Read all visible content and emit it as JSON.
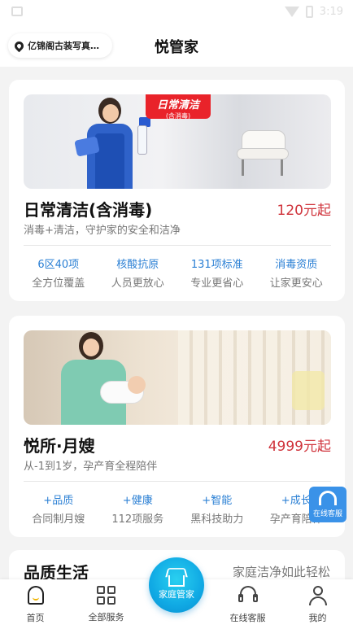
{
  "status_bar": {
    "time": "3:19"
  },
  "header": {
    "location": "亿锦阁古装写真…",
    "title": "悦管家"
  },
  "services": [
    {
      "banner_tag": "日常清洁",
      "banner_tag_sub": "(含消毒)",
      "title": "日常清洁(含消毒)",
      "price": "120元起",
      "subtitle": "消毒+清洁，守护家的安全和洁净",
      "features": [
        {
          "top": "6区40项",
          "bottom": "全方位覆盖"
        },
        {
          "top": "核酸抗原",
          "bottom": "人员更放心"
        },
        {
          "top": "131项标准",
          "bottom": "专业更省心"
        },
        {
          "top": "消毒资质",
          "bottom": "让家更安心"
        }
      ]
    },
    {
      "title": "悦所·月嫂",
      "price": "4999元起",
      "subtitle": "从-1到1岁，孕产育全程陪伴",
      "features": [
        {
          "top": "+品质",
          "bottom": "合同制月嫂"
        },
        {
          "top": "+健康",
          "bottom": "112项服务"
        },
        {
          "top": "+智能",
          "bottom": "黑科技助力"
        },
        {
          "top": "+成长",
          "bottom": "孕产育陪伴"
        }
      ]
    }
  ],
  "quality_section": {
    "title": "品质生活",
    "slogan": "家庭洁净如此轻松"
  },
  "float_service": {
    "label": "在线客服"
  },
  "tabbar": {
    "home": "首页",
    "all_services": "全部服务",
    "center": "家庭管家",
    "online_service": "在线客服",
    "mine": "我的"
  },
  "colors": {
    "price_red": "#d0343c",
    "feature_blue": "#2a7fd4",
    "accent_cyan": "#10a9e4",
    "tag_red": "#e9232a"
  },
  "icons": {
    "location": "location-pin-icon",
    "home": "home-smile-icon",
    "all_services": "grid-icon",
    "center": "house-icon",
    "online_service": "headset-icon",
    "mine": "user-icon"
  }
}
